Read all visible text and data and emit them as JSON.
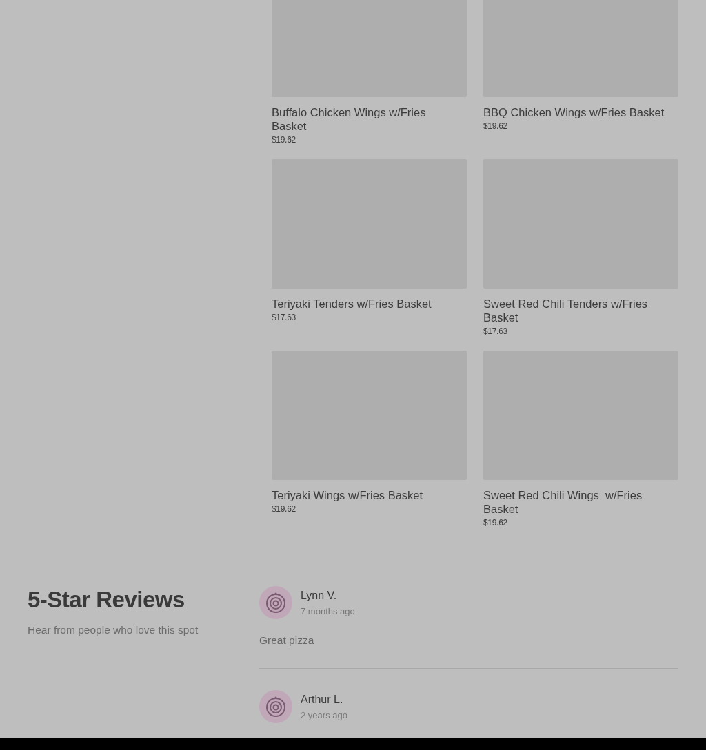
{
  "menu_items": [
    {
      "name": "Buffalo Chicken Wings w/Fries Basket",
      "price": "$19.62"
    },
    {
      "name": "BBQ Chicken Wings w/Fries Basket",
      "price": "$19.62"
    },
    {
      "name": "Teriyaki Tenders w/Fries Basket",
      "price": "$17.63"
    },
    {
      "name": "Sweet Red Chili Tenders w/Fries Basket",
      "price": "$17.63"
    },
    {
      "name": "Teriyaki Wings w/Fries Basket",
      "price": "$19.62"
    },
    {
      "name": "Sweet Red Chili Wings  w/Fries Basket",
      "price": "$19.62"
    }
  ],
  "reviews_section": {
    "title": "5-Star Reviews",
    "subtitle": "Hear from people who love this spot",
    "reviews": [
      {
        "author": "Lynn V.",
        "time": "7 months ago",
        "text": "Great pizza"
      },
      {
        "author": "Arthur L.",
        "time": "2 years ago"
      }
    ]
  }
}
